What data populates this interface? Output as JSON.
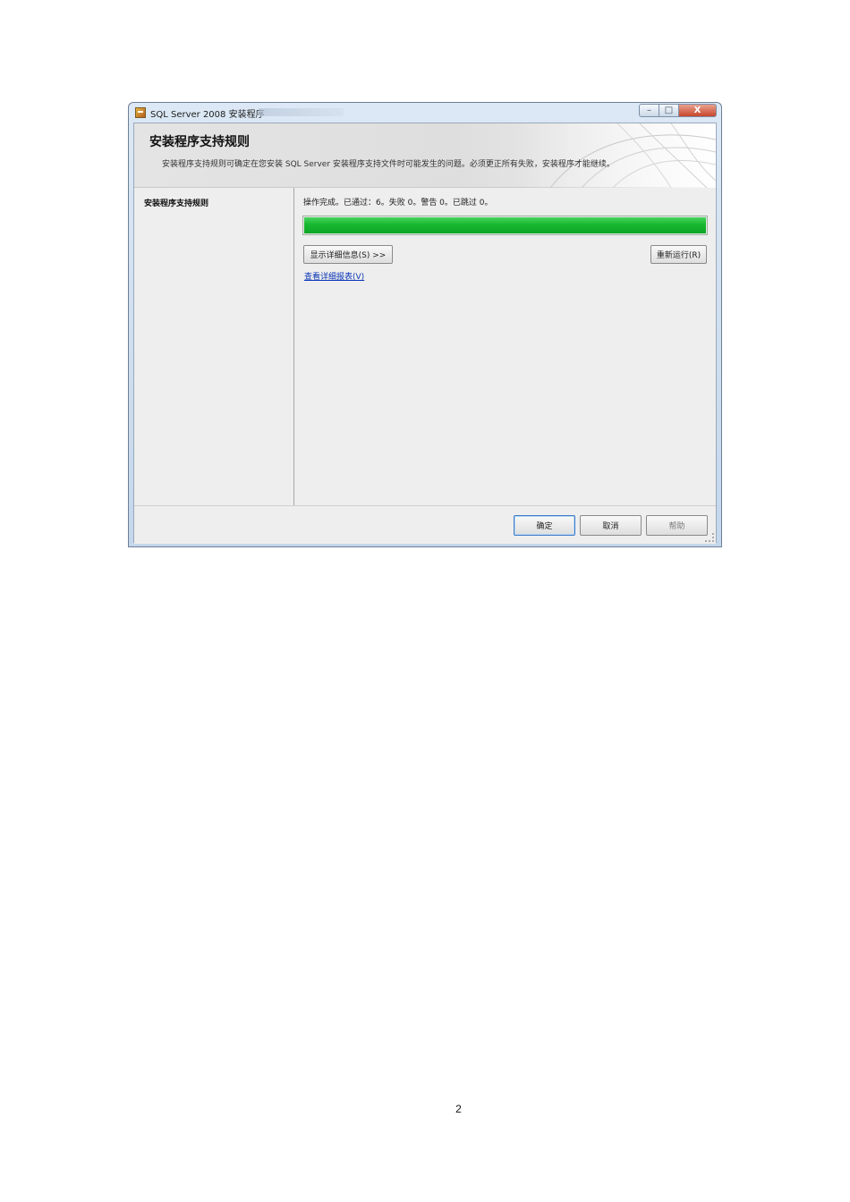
{
  "window": {
    "title": "SQL Server 2008 安装程序",
    "controls": {
      "minimize": "–",
      "maximize": "□",
      "close": "X"
    }
  },
  "header": {
    "title": "安装程序支持规则",
    "description": "安装程序支持规则可确定在您安装 SQL Server 安装程序支持文件时可能发生的问题。必须更正所有失败，安装程序才能继续。"
  },
  "sidebar": {
    "items": [
      {
        "label": "安装程序支持规则",
        "selected": true
      }
    ]
  },
  "main": {
    "status": "操作完成。已通过：6。失败 0。警告 0。已跳过 0。",
    "progress": 1.0,
    "show_details_button": "显示详细信息(S) >>",
    "rerun_button": "重新运行(R)",
    "report_link": "查看详细报表(V)"
  },
  "footer": {
    "ok_button": "确定",
    "cancel_button": "取消",
    "help_button": "帮助"
  },
  "page_number": "2",
  "colors": {
    "progress_green": "#17b82f",
    "link_blue": "#0b35b7",
    "close_red": "#c8462c"
  },
  "icons": [
    "sql-server-setup-icon",
    "minimize-icon",
    "maximize-icon",
    "close-icon",
    "resize-grip-icon"
  ]
}
